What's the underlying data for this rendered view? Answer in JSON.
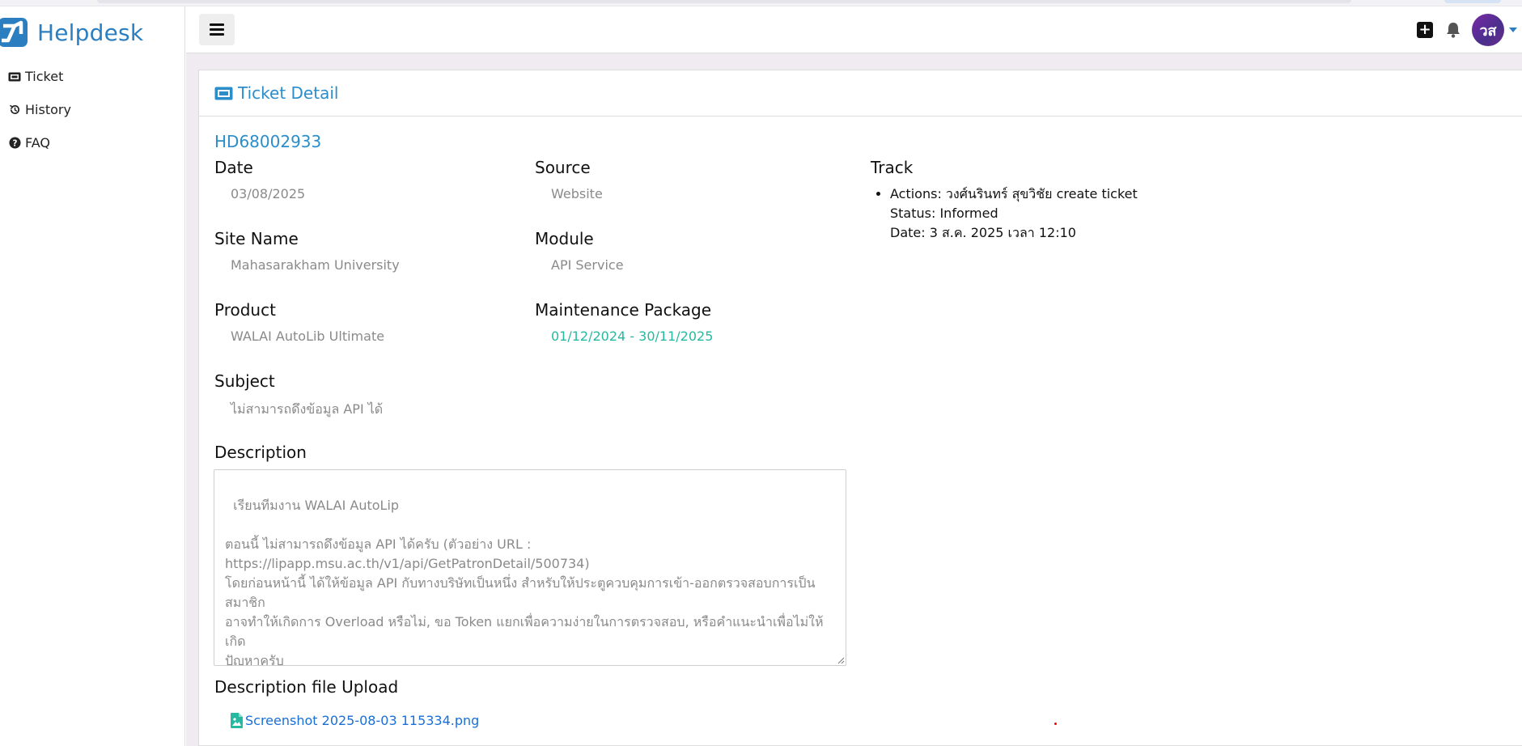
{
  "app": {
    "brand": "Helpdesk",
    "brand_color": "#2b7fc1",
    "accent_color": "#2b8ecb"
  },
  "sidebar": {
    "items": [
      {
        "label": "Ticket",
        "icon": "ticket-icon"
      },
      {
        "label": "History",
        "icon": "history-icon"
      },
      {
        "label": "FAQ",
        "icon": "question-circle-icon"
      }
    ]
  },
  "header": {
    "avatar_initials": "วส",
    "icons": [
      "hamburger-icon",
      "plus-square-icon",
      "bell-icon",
      "caret-down-icon"
    ]
  },
  "card": {
    "title": "Ticket Detail",
    "ticket_id": "HD68002933"
  },
  "fields": {
    "date": {
      "label": "Date",
      "value": "03/08/2025"
    },
    "source": {
      "label": "Source",
      "value": "Website"
    },
    "site_name": {
      "label": "Site Name",
      "value": "Mahasarakham University"
    },
    "module": {
      "label": "Module",
      "value": "API Service"
    },
    "product": {
      "label": "Product",
      "value": "WALAI AutoLib Ultimate"
    },
    "maintenance": {
      "label": "Maintenance Package",
      "value": "01/12/2024 - 30/11/2025",
      "color": "#26b8a0"
    },
    "subject": {
      "label": "Subject",
      "value": "ไม่สามารถดึงข้อมูล API ได้"
    },
    "description": {
      "label": "Description",
      "value": "เรียนทีมงาน WALAI AutoLip\n\nตอนนี้ ไม่สามารถดึงข้อมูล API ได้ครับ (ตัวอย่าง URL :\nhttps://lipapp.msu.ac.th/v1/api/GetPatronDetail/500734)\nโดยก่อนหน้านี้ ได้ให้ข้อมูล API กับทางบริษัทเป็นหนึ่ง สำหรับให้ประตูควบคุมการเข้า-ออกตรวจสอบการเป็นสมาชิก\nอาจทำให้เกิดการ Overload หรือไม่, ขอ Token แยกเพื่อความง่ายในการตรวจสอบ, หรือคำแนะนำเพื่อไม่ให้เกิด\nปัญหาครับ\n\nขอบคุณครับ"
    },
    "file_upload": {
      "label": "Description file Upload",
      "file_name": "Screenshot 2025-08-03 115334.png"
    }
  },
  "track": {
    "label": "Track",
    "entries": [
      {
        "actions": "Actions: วงศ์นรินทร์ สุขวิชัย create ticket",
        "status": "Status: Informed",
        "date": "Date: 3 ส.ค. 2025 เวลา 12:10"
      }
    ]
  }
}
